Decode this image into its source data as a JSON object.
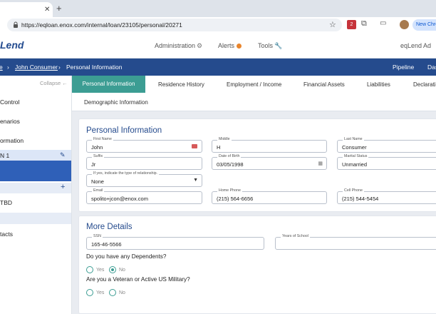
{
  "browser": {
    "url": "https://eqloan.enox.com/internal/loan/23105/personal/20271",
    "ext_badge_count": "2",
    "new_chrome_label": "New Chrome"
  },
  "app": {
    "logo": "Lend",
    "nav": {
      "administration": "Administration",
      "alerts": "Alerts",
      "tools": "Tools"
    },
    "app_name": "eqLend Ad"
  },
  "breadcrumb": {
    "home": "e",
    "borrower": "John Consumer",
    "current": "Personal Information",
    "pipeline": "Pipeline",
    "dash": "Das"
  },
  "sidebar": {
    "collapse_label": "Collapse",
    "items": [
      "Control",
      "enarios",
      "ormation",
      "N 1",
      "TBD",
      "tacts"
    ]
  },
  "tabs": [
    "Personal Information",
    "Residence History",
    "Employment / Income",
    "Financial Assets",
    "Liabilities",
    "Declarati",
    "Demographic Information"
  ],
  "personal": {
    "title": "Personal Information",
    "first_name": {
      "label": "First Name",
      "value": "John"
    },
    "middle": {
      "label": "Middle",
      "value": "H"
    },
    "last_name": {
      "label": "Last Name",
      "value": "Consumer"
    },
    "suffix": {
      "label": "Suffix",
      "value": "Jr"
    },
    "dob": {
      "label": "Date of Birth",
      "value": "03/05/1998"
    },
    "marital": {
      "label": "Marital Status",
      "value": "Unmarried"
    },
    "relationship": {
      "label": "If yes, indicate the type of relationship.",
      "value": "None"
    },
    "email": {
      "label": "Email",
      "value": "spolito+jcon@enox.com"
    },
    "home_phone": {
      "label": "Home Phone",
      "value": "(215) 564-6656"
    },
    "cell_phone": {
      "label": "Cell Phone",
      "value": "(215) 544-5454"
    }
  },
  "more": {
    "title": "More Details",
    "ssn": {
      "label": "SSN",
      "value": "165-46-5566"
    },
    "years_school": {
      "label": "Years of School",
      "value": ""
    },
    "dependents_q": "Do you have any Dependents?",
    "veteran_q": "Are you a Veteran or Active US Military?",
    "yes": "Yes",
    "no": "No"
  },
  "colors": {
    "accent": "#3c9d93",
    "brand": "#254b8d"
  }
}
